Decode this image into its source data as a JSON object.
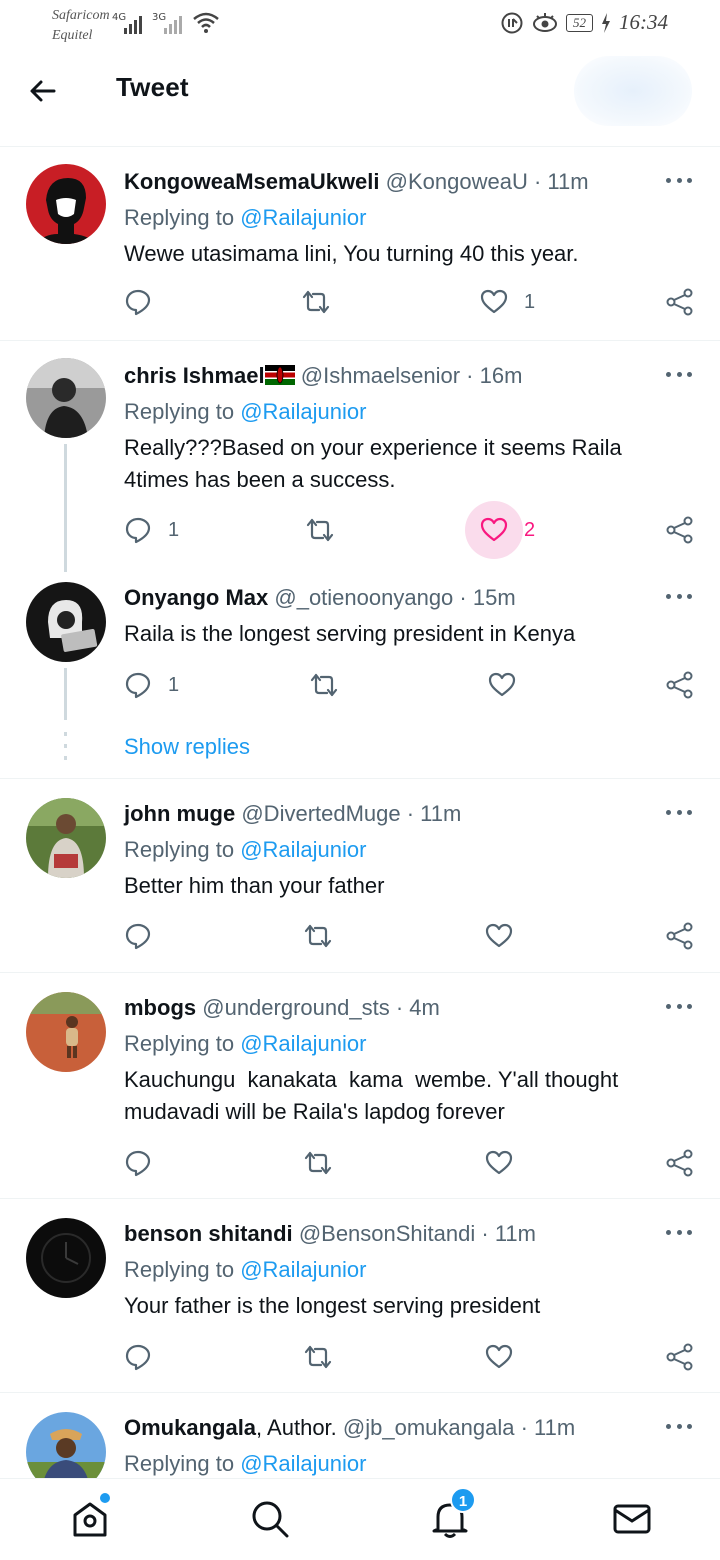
{
  "status_bar": {
    "carrier1": "Safaricom",
    "carrier2": "Equitel",
    "net1": "4G",
    "net2": "3G",
    "battery": "52",
    "time": "16:34"
  },
  "header": {
    "title": "Tweet"
  },
  "replying_label": "Replying to",
  "tweets": [
    {
      "name": "KongoweaMsemaUkweli",
      "handle": "@KongoweaU · 11m",
      "replying_to": "@Railajunior",
      "text": "Wewe utasimama lini, You turning 40 this year.",
      "replies": "",
      "likes": "1"
    },
    {
      "name": "chris Ishmael",
      "handle": "@Ishmaelsenior · 16m",
      "replying_to": "@Railajunior",
      "text": "Really???Based on your experience it seems Raila 4times has been a success.",
      "replies": "1",
      "likes": "2"
    },
    {
      "name": "Onyango Max",
      "handle": "@_otienoonyango · 15m",
      "text": "Raila is the longest serving president in Kenya",
      "replies": "1",
      "likes": ""
    },
    {
      "name": "john muge",
      "handle": "@DivertedMuge · 11m",
      "replying_to": "@Railajunior",
      "text": "Better him than your father",
      "replies": "",
      "likes": ""
    },
    {
      "name": "mbogs",
      "handle": "@underground_sts · 4m",
      "replying_to": "@Railajunior",
      "text": "Kauchungu  kanakata  kama  wembe. Y'all thought mudavadi will be Raila's lapdog forever",
      "replies": "",
      "likes": ""
    },
    {
      "name": "benson shitandi",
      "handle": "@BensonShitandi · 11m",
      "replying_to": "@Railajunior",
      "text": "Your father is the longest serving president",
      "replies": "",
      "likes": ""
    },
    {
      "name": "Omukangala",
      "name_suffix": ", Author.",
      "handle": "@jb_omukangala · 11m",
      "replying_to": "@Railajunior"
    }
  ],
  "show_replies": "Show replies",
  "nav": {
    "notifications_badge": "1"
  },
  "colors": {
    "accent": "#1d9bf0",
    "like": "#f91880",
    "muted": "#536471"
  }
}
